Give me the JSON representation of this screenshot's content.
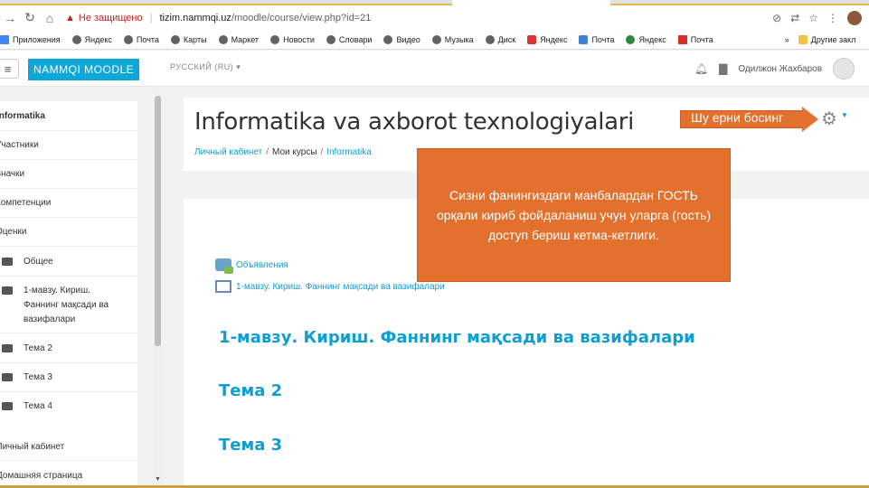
{
  "browser": {
    "security_label": "Не защищено",
    "url_domain": "tizim.nammqi.uz",
    "url_path": "/moodle/course/view.php?id=21"
  },
  "bookmarks": [
    {
      "label": "Приложения",
      "icon": "apps-icon"
    },
    {
      "label": "Яндекс",
      "icon": "globe-icon"
    },
    {
      "label": "Почта",
      "icon": "globe-icon"
    },
    {
      "label": "Карты",
      "icon": "globe-icon"
    },
    {
      "label": "Маркет",
      "icon": "globe-icon"
    },
    {
      "label": "Новости",
      "icon": "globe-icon"
    },
    {
      "label": "Словари",
      "icon": "globe-icon"
    },
    {
      "label": "Видео",
      "icon": "globe-icon"
    },
    {
      "label": "Музыка",
      "icon": "globe-icon"
    },
    {
      "label": "Диск",
      "icon": "globe-icon"
    },
    {
      "label": "Яндекс",
      "icon": "yandex-icon"
    },
    {
      "label": "Почта",
      "icon": "mail-icon"
    },
    {
      "label": "Яндекс",
      "icon": "globe-icon"
    },
    {
      "label": "Почта",
      "icon": "gmail-icon"
    }
  ],
  "bookmarks_overflow": "»",
  "other_bookmarks": "Другие закл",
  "moodle": {
    "site_name": "NAMMQI MOODLE",
    "language": "РУССКИЙ (RU)",
    "user_name": "Одилжон Жахбаров"
  },
  "drawer": {
    "items": [
      {
        "label": "Informatika"
      },
      {
        "label": "Участники"
      },
      {
        "label": "Значки"
      },
      {
        "label": "Компетенции"
      },
      {
        "label": "Оценки"
      },
      {
        "label": "Общее"
      },
      {
        "label": "1-мавзу. Кириш. Фаннинг мақсади ва вазифалари"
      },
      {
        "label": "Тема 2"
      },
      {
        "label": "Тема 3"
      },
      {
        "label": "Тема 4"
      }
    ],
    "bottom_items": [
      {
        "label": "Личный кабинет"
      },
      {
        "label": "Домашняя страница"
      }
    ]
  },
  "page": {
    "title": "Informatika va axborot texnologiyalari",
    "breadcrumb": [
      "Личный кабинет",
      "Мои курсы",
      "Informatika"
    ]
  },
  "activities": [
    {
      "label": "Объявления",
      "icon": "forum-icon"
    },
    {
      "label": "1-мавзу. Кириш. Фаннинг мақсади ва вазифалари",
      "icon": "page-icon"
    }
  ],
  "sections": [
    {
      "title": "1-мавзу. Кириш. Фаннинг мақсади ва вазифалари"
    },
    {
      "title": "Тема 2"
    },
    {
      "title": "Тема 3"
    }
  ],
  "annotations": {
    "arrow_label": "Шу ерни босинг",
    "info_text": "Сизни фанингиздаги манбалардан ГОСТЬ орқали кириб фойдаланиш учун уларга (гость) доступ бериш кетма-кетлиги."
  },
  "colors": {
    "accent": "#0fa6d8",
    "annotation_orange": "#e3702c",
    "link": "#0f9ed1"
  }
}
